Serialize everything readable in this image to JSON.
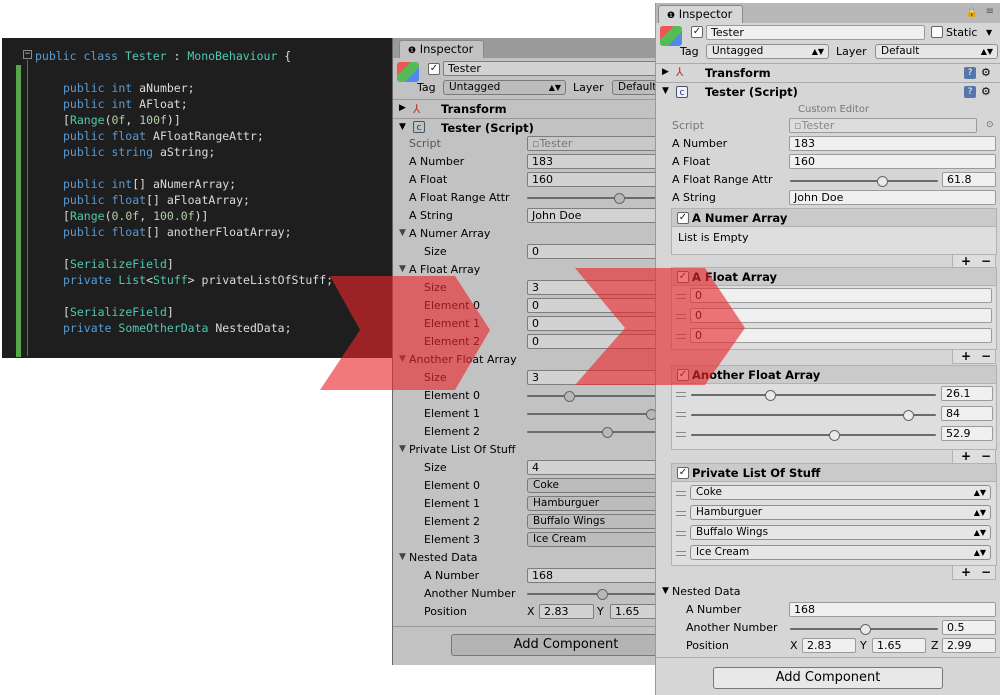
{
  "code": {
    "lines": [
      {
        "t": "public class Tester : MonoBehaviour {",
        "kind": "class"
      },
      {
        "t": "public int aNumber;",
        "kind": "decl",
        "kw": "public int",
        "rest": " aNumber;"
      },
      {
        "t": "public int AFloat;",
        "kind": "decl",
        "kw": "public int",
        "rest": " AFloat;"
      },
      {
        "t": "[Range(0f, 100f)]",
        "kind": "attr"
      },
      {
        "t": "public float AFloatRangeAttr;",
        "kind": "decl",
        "kw": "public float",
        "rest": " AFloatRangeAttr;"
      },
      {
        "t": "public string aString;",
        "kind": "decl",
        "kw": "public string",
        "rest": " aString;"
      },
      {
        "t": "public int[] aNumerArray;",
        "kind": "decl",
        "kw": "public int",
        "rest": "[] aNumerArray;"
      },
      {
        "t": "public float[] aFloatArray;",
        "kind": "decl",
        "kw": "public float",
        "rest": "[] aFloatArray;"
      },
      {
        "t": "[Range(0.0f, 100.0f)]",
        "kind": "attr"
      },
      {
        "t": "public float[] anotherFloatArray;",
        "kind": "decl",
        "kw": "public float",
        "rest": "[] anotherFloatArray;"
      },
      {
        "t": "[SerializeField]",
        "kind": "sf"
      },
      {
        "t": "private List<Stuff> privateListOfStuff;",
        "kind": "list"
      },
      {
        "t": "[SerializeField]",
        "kind": "sf"
      },
      {
        "t": "private SomeOtherData NestedData;",
        "kind": "other"
      }
    ]
  },
  "left": {
    "tab": "Inspector",
    "object_name": "Tester",
    "tag_label": "Tag",
    "tag_value": "Untagged",
    "layer_label": "Layer",
    "layer_value": "Default",
    "transform": "Transform",
    "script_header": "Tester (Script)",
    "script_label": "Script",
    "script_value": "Tester",
    "a_number_label": "A Number",
    "a_number": "183",
    "a_float_label": "A Float",
    "a_float": "160",
    "range_label": "A Float Range Attr",
    "a_string_label": "A String",
    "a_string": "John Doe",
    "numer_array": "A Numer Array",
    "size_label": "Size",
    "numer_size": "0",
    "float_array": "A Float Array",
    "float_size": "3",
    "el0": "Element 0",
    "el1": "Element 1",
    "el2": "Element 2",
    "el3": "Element 3",
    "float_vals": [
      "0",
      "0",
      "0"
    ],
    "another_array": "Another Float Array",
    "another_size": "3",
    "private_list": "Private List Of Stuff",
    "list_size": "4",
    "list_items": [
      "Coke",
      "Hamburguer",
      "Buffalo Wings",
      "Ice Cream"
    ],
    "nested": "Nested Data",
    "nested_a_number_label": "A Number",
    "nested_a_number": "168",
    "another_number_label": "Another Number",
    "position_label": "Position",
    "pos_x": "2.83",
    "pos_y": "1.65",
    "x_label": "X",
    "y_label": "Y",
    "add_component": "Add Component"
  },
  "right": {
    "tab": "Inspector",
    "object_name": "Tester",
    "static_label": "Static",
    "tag_label": "Tag",
    "tag_value": "Untagged",
    "layer_label": "Layer",
    "layer_value": "Default",
    "transform": "Transform",
    "script_header": "Tester (Script)",
    "custom_editor": "Custom Editor",
    "script_label": "Script",
    "script_value": "Tester",
    "a_number_label": "A Number",
    "a_number": "183",
    "a_float_label": "A Float",
    "a_float": "160",
    "range_label": "A Float Range Attr",
    "range_value": "61.8",
    "a_string_label": "A String",
    "a_string": "John Doe",
    "numer_array": "A Numer Array",
    "list_empty": "List is Empty",
    "float_array": "A Float Array",
    "float_vals": [
      "0",
      "0",
      "0"
    ],
    "another_array": "Another Float Array",
    "another_vals": [
      "26.1",
      "84",
      "52.9"
    ],
    "private_list": "Private List Of Stuff",
    "list_items": [
      "Coke",
      "Hamburguer",
      "Buffalo Wings",
      "Ice Cream"
    ],
    "nested": "Nested Data",
    "nested_a_number_label": "A Number",
    "nested_a_number": "168",
    "another_number_label": "Another Number",
    "another_number": "0.5",
    "position_label": "Position",
    "x_label": "X",
    "y_label": "Y",
    "z_label": "Z",
    "pos_x": "2.83",
    "pos_y": "1.65",
    "pos_z": "2.99",
    "plus": "+",
    "minus": "−",
    "add_component": "Add Component"
  },
  "colors": {
    "arrow": "#e8252a",
    "code_bg": "#1e1e1e",
    "keyword": "#569cd6",
    "type": "#4ec9b0",
    "number": "#b5cea8"
  }
}
